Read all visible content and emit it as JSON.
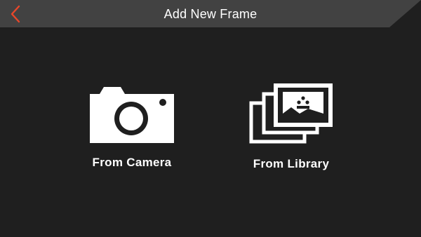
{
  "header": {
    "title": "Add New Frame",
    "back_icon": "chevron-left-icon",
    "back_color": "#e8472a",
    "bg_color": "#424242"
  },
  "options": [
    {
      "id": "camera",
      "label": "From Camera",
      "icon": "camera-icon"
    },
    {
      "id": "library",
      "label": "From Library",
      "icon": "photo-stack-icon"
    }
  ],
  "colors": {
    "background": "#1f1f1f",
    "foreground": "#ffffff"
  }
}
